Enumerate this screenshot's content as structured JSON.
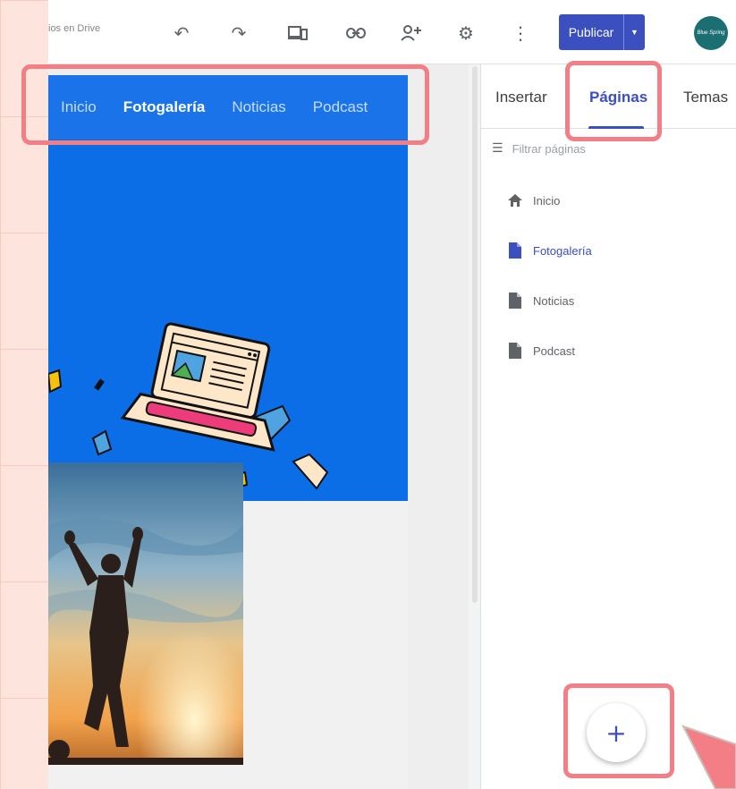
{
  "toolbar": {
    "drive_text": "ios en Drive",
    "undo_icon": "undo-icon",
    "redo_icon": "redo-icon",
    "preview_icon": "device-preview-icon",
    "link_icon": "link-icon",
    "share_icon": "add-person-icon",
    "settings_icon": "gear-icon",
    "more_icon": "more-vert-icon",
    "publish_label": "Publicar",
    "avatar_text": "Blue Spring"
  },
  "site": {
    "nav": [
      "Inicio",
      "Fotogalería",
      "Noticias",
      "Podcast"
    ],
    "active_nav": "Fotogalería",
    "hero_color": "#0b6ee6"
  },
  "panel": {
    "tabs": [
      "Insertar",
      "Páginas",
      "Temas"
    ],
    "active_tab": "Páginas",
    "filter_placeholder": "Filtrar páginas",
    "pages": [
      {
        "label": "Inicio",
        "icon": "home-icon"
      },
      {
        "label": "Fotogalería",
        "icon": "page-icon"
      },
      {
        "label": "Noticias",
        "icon": "page-icon"
      },
      {
        "label": "Podcast",
        "icon": "page-icon"
      }
    ],
    "active_page": "Fotogalería",
    "fab_label": "+"
  },
  "colors": {
    "accent": "#3c4fbf",
    "site_blue": "#1a73e8",
    "highlight": "#f47e86",
    "background": "#fde4dc"
  }
}
